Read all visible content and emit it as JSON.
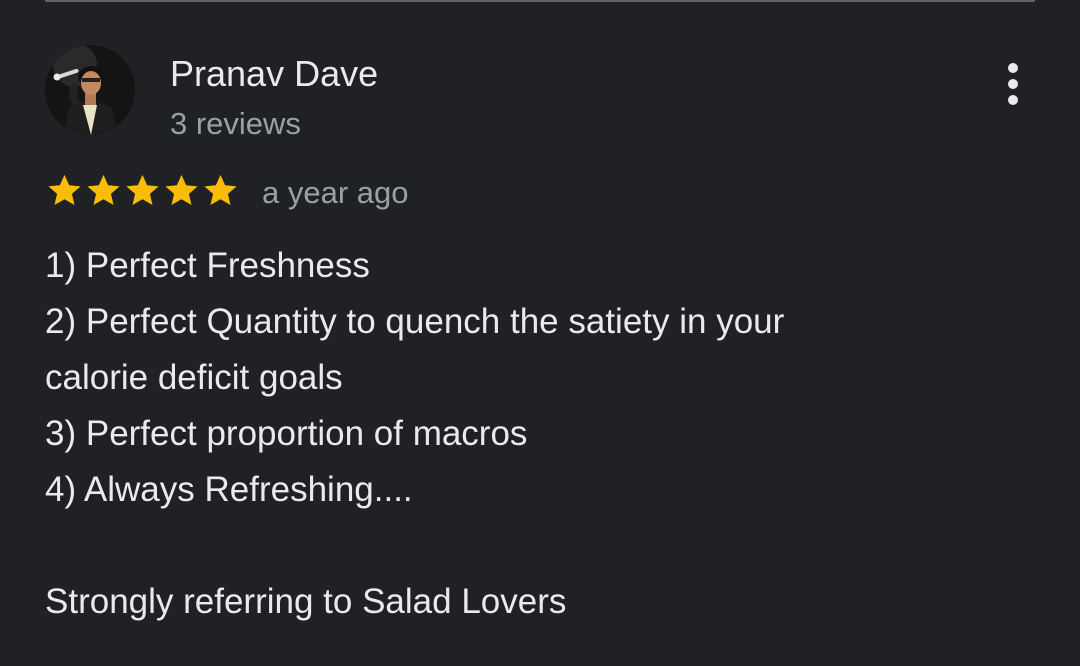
{
  "review": {
    "reviewer_name": "Pranav Dave",
    "review_count": "3 reviews",
    "rating": 5,
    "rating_max": 5,
    "date": "a year ago",
    "lines": [
      "1) Perfect Freshness",
      "2) Perfect Quantity to quench the satiety in your",
      "calorie deficit goals",
      "3) Perfect proportion of macros",
      "4) Always Refreshing....",
      "",
      "Strongly referring to Salad Lovers"
    ]
  },
  "icons": {
    "more": "more-vert-icon",
    "star": "star-icon",
    "avatar": "profile-photo"
  },
  "colors": {
    "background": "#202124",
    "primary_text": "#e8eaed",
    "secondary_text": "#9aa0a6",
    "star": "#fbbc04",
    "divider": "#5f6368"
  }
}
